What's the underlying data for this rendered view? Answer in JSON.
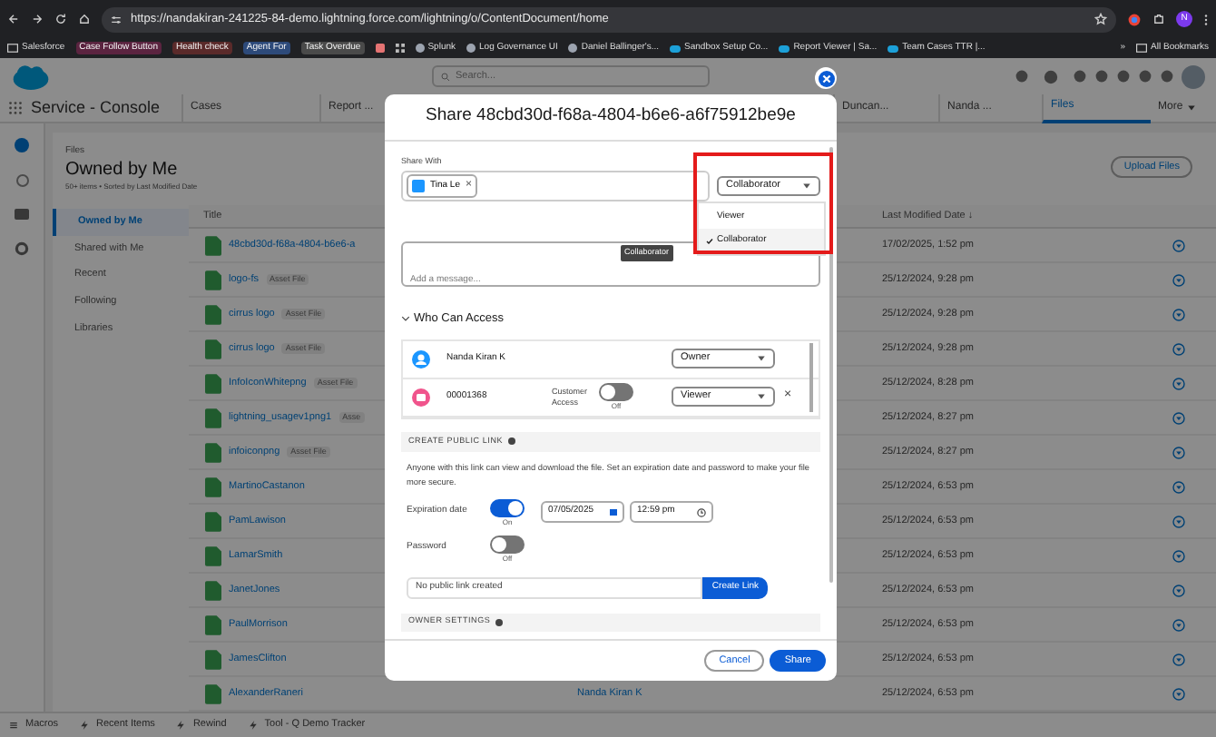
{
  "browser": {
    "url": "https://nandakiran-241225-84-demo.lightning.force.com/lightning/o/ContentDocument/home",
    "bookmarks": [
      {
        "kind": "folder",
        "label": "Salesforce"
      },
      {
        "kind": "tag",
        "label": "Case Follow Button",
        "color": "#5b2440"
      },
      {
        "kind": "tag",
        "label": "Health check",
        "color": "#5a2a2a"
      },
      {
        "kind": "tag",
        "label": "Agent For",
        "color": "#2d4a7a"
      },
      {
        "kind": "tag",
        "label": "Task Overdue",
        "color": "#4a4a4a"
      },
      {
        "kind": "square"
      },
      {
        "kind": "grid"
      },
      {
        "kind": "link",
        "label": "Splunk"
      },
      {
        "kind": "link",
        "label": "Log Governance UI"
      },
      {
        "kind": "link",
        "label": "Daniel Ballinger's..."
      },
      {
        "kind": "cloud",
        "label": "Sandbox Setup Co..."
      },
      {
        "kind": "cloud",
        "label": "Report Viewer | Sa..."
      },
      {
        "kind": "cloud",
        "label": "Team Cases TTR |..."
      }
    ],
    "overflow": "»",
    "all_bookmarks": "All Bookmarks",
    "profile_letter": "N"
  },
  "app": {
    "search": {
      "placeholder": "Search..."
    },
    "name": "Service - Console",
    "tabs": [
      {
        "label": "Cases",
        "selected": false
      },
      {
        "label": "Report ...",
        "selected": false
      },
      {
        "label": "Duncan...",
        "selected": false
      },
      {
        "label": "Nanda ...",
        "selected": false
      },
      {
        "label": "Files",
        "selected": true
      }
    ],
    "more": "More"
  },
  "files": {
    "section": "Files",
    "title": "Owned by Me",
    "subtitle": "50+ items • Sorted by Last Modified Date",
    "upload": "Upload Files",
    "nav": [
      {
        "label": "Owned by Me",
        "selected": true
      },
      {
        "label": "Shared with Me",
        "selected": false
      },
      {
        "label": "Recent",
        "selected": false
      },
      {
        "label": "Following",
        "selected": false
      },
      {
        "label": "Libraries",
        "selected": false
      }
    ],
    "columns": [
      "Title",
      "Last Modified Date ↓"
    ],
    "rows": [
      {
        "title": "48cbd30d-f68a-4804-b6e6-a",
        "date": "17/02/2025, 1:52 pm"
      },
      {
        "title": "logo-fs",
        "badge": "Asset File",
        "date": "25/12/2024, 9:28 pm"
      },
      {
        "title": "cirrus logo",
        "badge": "Asset File",
        "date": "25/12/2024, 9:28 pm"
      },
      {
        "title": "cirrus logo",
        "badge": "Asset File",
        "date": "25/12/2024, 9:28 pm"
      },
      {
        "title": "InfoIconWhitepng",
        "badge": "Asset File",
        "date": "25/12/2024, 8:28 pm"
      },
      {
        "title": "lightning_usagev1png1",
        "badge": "Asse",
        "date": "25/12/2024, 8:27 pm"
      },
      {
        "title": "infoiconpng",
        "badge": "Asset File",
        "date": "25/12/2024, 8:27 pm"
      },
      {
        "title": "MartinoCastanon",
        "date": "25/12/2024, 6:53 pm"
      },
      {
        "title": "PamLawison",
        "date": "25/12/2024, 6:53 pm"
      },
      {
        "title": "LamarSmith",
        "date": "25/12/2024, 6:53 pm"
      },
      {
        "title": "JanetJones",
        "date": "25/12/2024, 6:53 pm"
      },
      {
        "title": "PaulMorrison",
        "date": "25/12/2024, 6:53 pm"
      },
      {
        "title": "JamesClifton",
        "date": "25/12/2024, 6:53 pm"
      },
      {
        "title": "AlexanderRaneri",
        "owner": "Nanda Kiran K",
        "date": "25/12/2024, 6:53 pm"
      }
    ]
  },
  "utility_bar": [
    {
      "kind": "list",
      "label": "Macros"
    },
    {
      "kind": "bolt",
      "label": "Recent Items"
    },
    {
      "kind": "bolt",
      "label": "Rewind"
    },
    {
      "kind": "bolt",
      "label": "Tool - Q Demo Tracker"
    }
  ],
  "modal": {
    "title": "Share 48cbd30d-f68a-4804-b6e6-a6f75912be9e",
    "share_with_label": "Share With",
    "recipient": "Tina Le",
    "recipient_remove": "×",
    "access_select": "Collaborator",
    "access_options": [
      {
        "label": "Viewer",
        "selected": false
      },
      {
        "label": "Collaborator",
        "selected": true
      }
    ],
    "message_placeholder": "Add a message...",
    "tooltip": "Collaborator",
    "who_can_access": {
      "title": "Who Can Access",
      "expanded": true,
      "people": [
        {
          "kind": "user",
          "name": "Nanda Kiran K",
          "access": "Owner"
        },
        {
          "kind": "record",
          "name": "00001368",
          "customer_access_label": "Customer Access",
          "customer_access": {
            "on": false,
            "caption": "Off"
          },
          "access": "Viewer",
          "remove": "×"
        }
      ]
    },
    "public_link": {
      "heading": "CREATE PUBLIC LINK",
      "description": "Anyone with this link can view and download the file. Set an expiration date and password to make your file more secure.",
      "expiration": {
        "label": "Expiration date",
        "on": true,
        "caption": "On",
        "date": "07/05/2025",
        "time": "12:59 pm"
      },
      "password": {
        "label": "Password",
        "on": false,
        "caption": "Off"
      },
      "link_placeholder": "No public link created",
      "create": "Create Link"
    },
    "owner_settings": "OWNER SETTINGS",
    "cancel": "Cancel",
    "share": "Share"
  }
}
